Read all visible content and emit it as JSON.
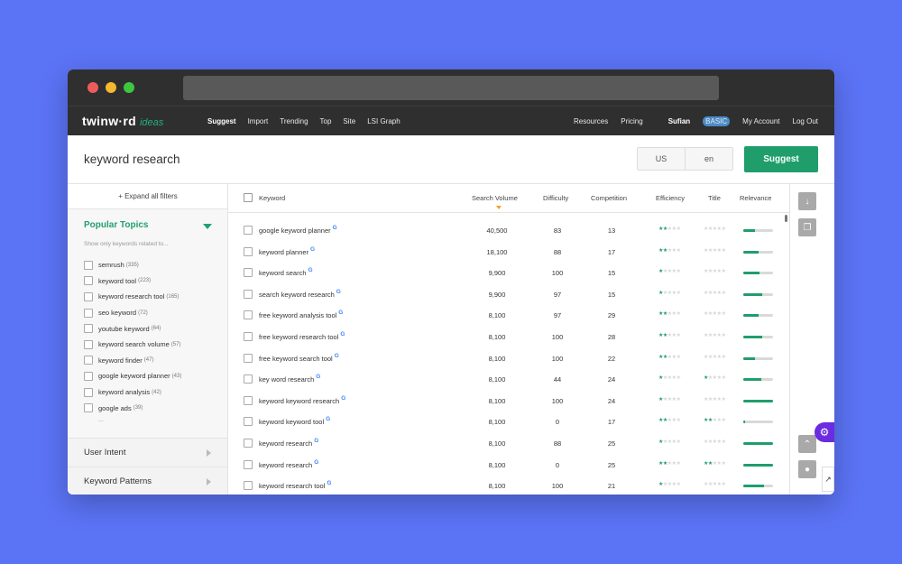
{
  "nav": {
    "logo_main": "twinw·rd",
    "logo_sub": "ideas",
    "left_links": [
      "Suggest",
      "Import",
      "Trending",
      "Top",
      "Site",
      "LSI Graph"
    ],
    "resources": "Resources",
    "pricing": "Pricing",
    "user": "Sufian",
    "badge": "BASIC",
    "account": "My Account",
    "logout": "Log Out"
  },
  "search": {
    "query": "keyword research",
    "country": "US",
    "language": "en",
    "button": "Suggest"
  },
  "sidebar": {
    "expand_label": "+ Expand all filters",
    "topics_title": "Popular Topics",
    "topics_hint": "Show only keywords related to...",
    "topics": [
      {
        "label": "semrush",
        "count": "(335)"
      },
      {
        "label": "keyword tool",
        "count": "(223)"
      },
      {
        "label": "keyword research tool",
        "count": "(165)"
      },
      {
        "label": "seo keyword",
        "count": "(72)"
      },
      {
        "label": "youtube keyword",
        "count": "(64)"
      },
      {
        "label": "keyword search volume",
        "count": "(57)"
      },
      {
        "label": "keyword finder",
        "count": "(47)"
      },
      {
        "label": "google keyword planner",
        "count": "(43)"
      },
      {
        "label": "keyword analysis",
        "count": "(42)"
      },
      {
        "label": "google ads",
        "count": "(39)"
      }
    ],
    "more": "...",
    "sections": [
      "User Intent",
      "Keyword Patterns"
    ]
  },
  "table": {
    "headers": {
      "keyword": "Keyword",
      "volume": "Search Volume",
      "difficulty": "Difficulty",
      "competition": "Competition",
      "efficiency": "Efficiency",
      "title": "Title",
      "relevance": "Relevance"
    },
    "rows": [
      {
        "keyword": "google keyword planner",
        "volume": "40,500",
        "difficulty": "83",
        "competition": "13",
        "efficiency": 2,
        "title": 0,
        "relevance": 0.4
      },
      {
        "keyword": "keyword planner",
        "volume": "18,100",
        "difficulty": "88",
        "competition": "17",
        "efficiency": 2,
        "title": 0,
        "relevance": 0.5
      },
      {
        "keyword": "keyword search",
        "volume": "9,900",
        "difficulty": "100",
        "competition": "15",
        "efficiency": 1,
        "title": 0,
        "relevance": 0.55
      },
      {
        "keyword": "search keyword research",
        "volume": "9,900",
        "difficulty": "97",
        "competition": "15",
        "efficiency": 1,
        "title": 0,
        "relevance": 0.65
      },
      {
        "keyword": "free keyword analysis tool",
        "volume": "8,100",
        "difficulty": "97",
        "competition": "29",
        "efficiency": 2,
        "title": 0,
        "relevance": 0.5
      },
      {
        "keyword": "free keyword research tool",
        "volume": "8,100",
        "difficulty": "100",
        "competition": "28",
        "efficiency": 2,
        "title": 0,
        "relevance": 0.65
      },
      {
        "keyword": "free keyword search tool",
        "volume": "8,100",
        "difficulty": "100",
        "competition": "22",
        "efficiency": 2,
        "title": 0,
        "relevance": 0.4
      },
      {
        "keyword": "key word research",
        "volume": "8,100",
        "difficulty": "44",
        "competition": "24",
        "efficiency": 1,
        "title": 1,
        "relevance": 0.6
      },
      {
        "keyword": "keyword keyword research",
        "volume": "8,100",
        "difficulty": "100",
        "competition": "24",
        "efficiency": 1,
        "title": 0,
        "relevance": 1.0
      },
      {
        "keyword": "keyword keyword tool",
        "volume": "8,100",
        "difficulty": "0",
        "competition": "17",
        "efficiency": 2,
        "title": 2,
        "relevance": 0.05
      },
      {
        "keyword": "keyword research",
        "volume": "8,100",
        "difficulty": "88",
        "competition": "25",
        "efficiency": 1,
        "title": 0,
        "relevance": 1.0
      },
      {
        "keyword": "keyword research",
        "volume": "8,100",
        "difficulty": "0",
        "competition": "25",
        "efficiency": 2,
        "title": 2,
        "relevance": 1.0
      },
      {
        "keyword": "keyword research tool",
        "volume": "8,100",
        "difficulty": "100",
        "competition": "21",
        "efficiency": 1,
        "title": 0,
        "relevance": 0.7
      }
    ]
  },
  "colors": {
    "background": "#5b73f5",
    "accent": "#1f9e6b",
    "navbar": "#2f2f2f",
    "purple_widget": "#6b2be0"
  }
}
